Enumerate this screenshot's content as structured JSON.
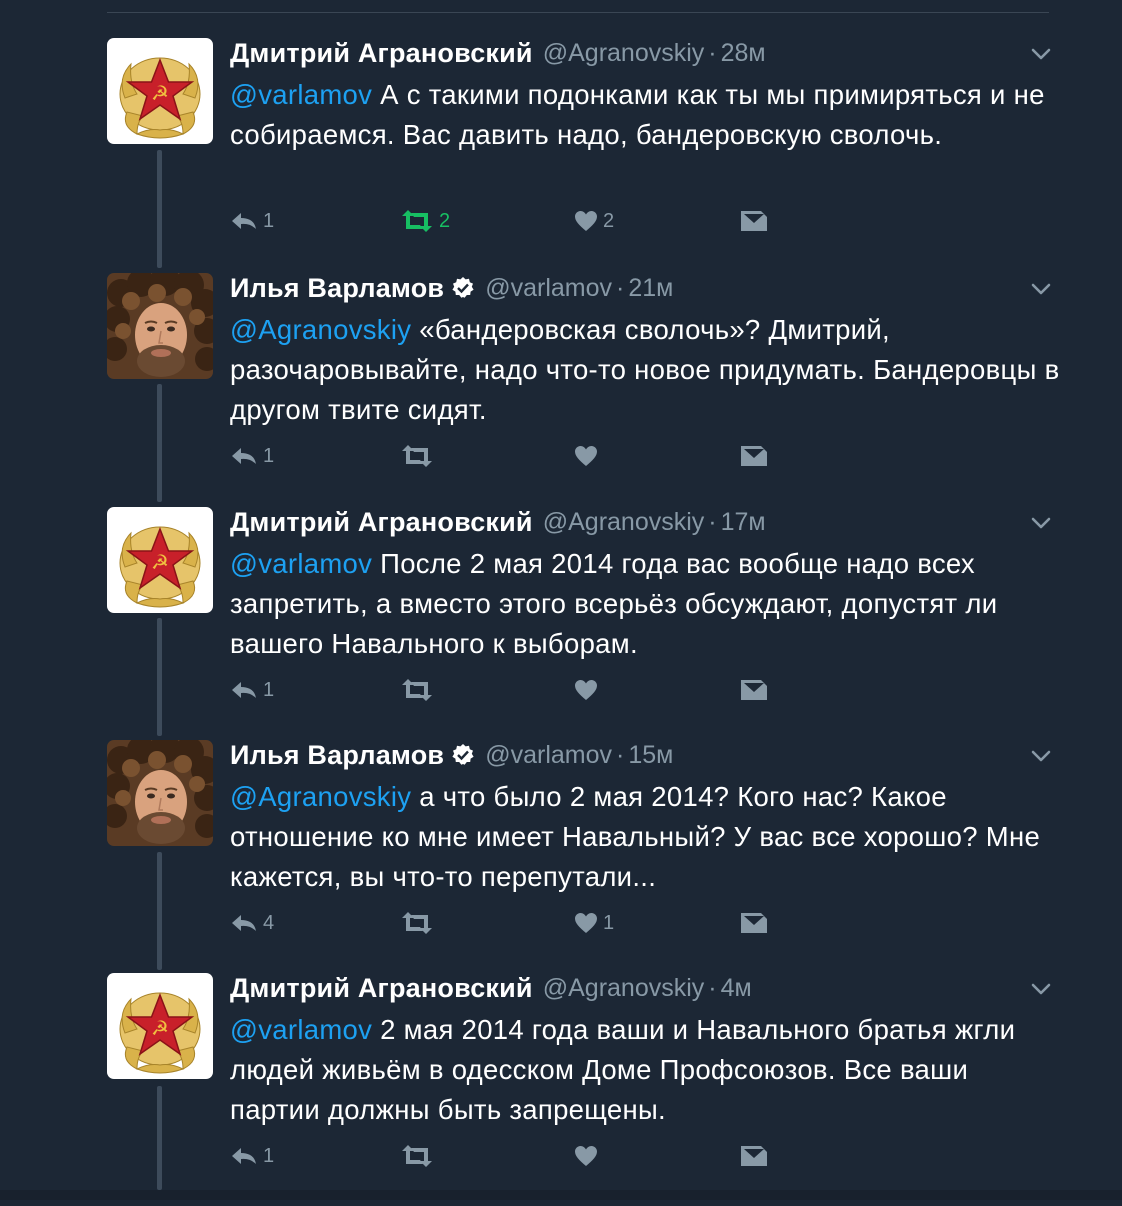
{
  "colors": {
    "background": "#1c2735",
    "mention": "#1da1f2",
    "muted": "#8899a6",
    "retweet_active": "#17bf63",
    "thread_line": "#3d4b5b"
  },
  "tweets": [
    {
      "avatar_icon": "soviet-star-cockade-icon",
      "name": "Дмитрий Аграновский",
      "verified": false,
      "handle": "@Agranovskiy",
      "separator": "·",
      "time": "28м",
      "mention": "@varlamov",
      "body": " А с такими подонками как ты мы примиряться и не собираемся. Вас давить надо, бандеровскую сволочь.",
      "reply_count": "1",
      "retweet_count": "2",
      "retweet_active": true,
      "like_count": "2"
    },
    {
      "avatar_icon": "curly-haired-man-photo",
      "name": "Илья Варламов",
      "verified": true,
      "handle": "@varlamov",
      "separator": "·",
      "time": "21м",
      "mention": "@Agranovskiy",
      "body": " «бандеровская сволочь»? Дмитрий, разочаровывайте, надо что-то новое придумать. Бандеровцы в другом твите сидят.",
      "reply_count": "1",
      "retweet_count": "",
      "retweet_active": false,
      "like_count": ""
    },
    {
      "avatar_icon": "soviet-star-cockade-icon",
      "name": "Дмитрий Аграновский",
      "verified": false,
      "handle": "@Agranovskiy",
      "separator": "·",
      "time": "17м",
      "mention": "@varlamov",
      "body": " После 2 мая 2014 года вас вообще надо всех запретить, а вместо этого всерьёз обсуждают, допустят ли вашего Навального к выборам.",
      "reply_count": "1",
      "retweet_count": "",
      "retweet_active": false,
      "like_count": ""
    },
    {
      "avatar_icon": "curly-haired-man-photo",
      "name": "Илья Варламов",
      "verified": true,
      "handle": "@varlamov",
      "separator": "·",
      "time": "15м",
      "mention": "@Agranovskiy",
      "body": " а что было 2 мая 2014? Кого нас? Какое отношение ко мне имеет Навальный? У вас все хорошо? Мне кажется, вы что-то перепутали...",
      "reply_count": "4",
      "retweet_count": "",
      "retweet_active": false,
      "like_count": "1"
    },
    {
      "avatar_icon": "soviet-star-cockade-icon",
      "name": "Дмитрий Аграновский",
      "verified": false,
      "handle": "@Agranovskiy",
      "separator": "·",
      "time": "4м",
      "mention": "@varlamov",
      "body": " 2 мая 2014 года ваши и Навального братья жгли людей живьём в одесском Доме Профсоюзов. Все ваши партии должны быть запрещены.",
      "reply_count": "1",
      "retweet_count": "",
      "retweet_active": false,
      "like_count": ""
    }
  ]
}
